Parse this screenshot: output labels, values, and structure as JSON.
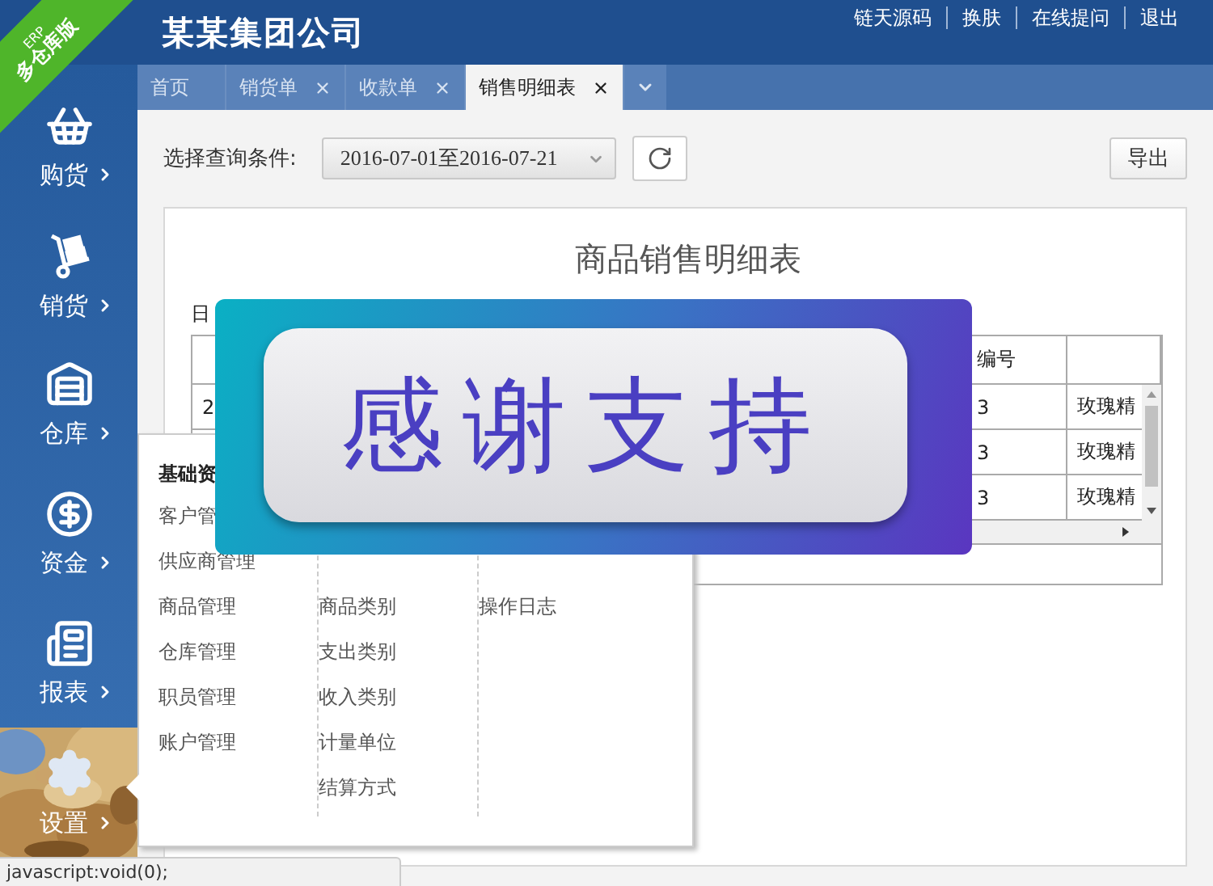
{
  "brand": {
    "badge": "ERP",
    "edition": "多仓库版",
    "company": "某某集团公司"
  },
  "top_links": [
    "链天源码",
    "换肤",
    "在线提问",
    "退出"
  ],
  "sidebar": [
    {
      "label": "购货",
      "kind": "basket",
      "selected": false
    },
    {
      "label": "销货",
      "kind": "handtruck",
      "selected": false
    },
    {
      "label": "仓库",
      "kind": "warehouse",
      "selected": false
    },
    {
      "label": "资金",
      "kind": "dollar",
      "selected": false
    },
    {
      "label": "报表",
      "kind": "report",
      "selected": false
    },
    {
      "label": "设置",
      "kind": "gear",
      "selected": true
    }
  ],
  "tabs": [
    {
      "label": "首页",
      "closable": false,
      "selected": false
    },
    {
      "label": "销货单",
      "closable": true,
      "selected": false
    },
    {
      "label": "收款单",
      "closable": true,
      "selected": false
    },
    {
      "label": "销售明细表",
      "closable": true,
      "selected": true
    }
  ],
  "query": {
    "label": "选择查询条件:",
    "date_range": "2016-07-01至2016-07-21"
  },
  "export_button": "导出",
  "report": {
    "title": "商品销售明细表",
    "date_label": "日",
    "header": {
      "column_3": "编号"
    },
    "rows": [
      {
        "column_1": "2",
        "column_3": "3",
        "column_4": "玫瑰精"
      },
      {
        "column_3": "3",
        "column_4": "玫瑰精"
      },
      {
        "column_3": "3",
        "column_4": "玫瑰精"
      }
    ]
  },
  "menu": {
    "heading": "基础资",
    "columns": [
      {
        "items": [
          "客户管",
          "供应商管理",
          "商品管理",
          "仓库管理",
          "职员管理",
          "账户管理"
        ]
      },
      {
        "items": [
          "商品类别",
          "支出类别",
          "收入类别",
          "计量单位",
          "结算方式"
        ]
      },
      {
        "items": [
          "操作日志"
        ]
      }
    ]
  },
  "banner": {
    "text": "感谢支持"
  },
  "status_bar": "javascript:void(0);"
}
